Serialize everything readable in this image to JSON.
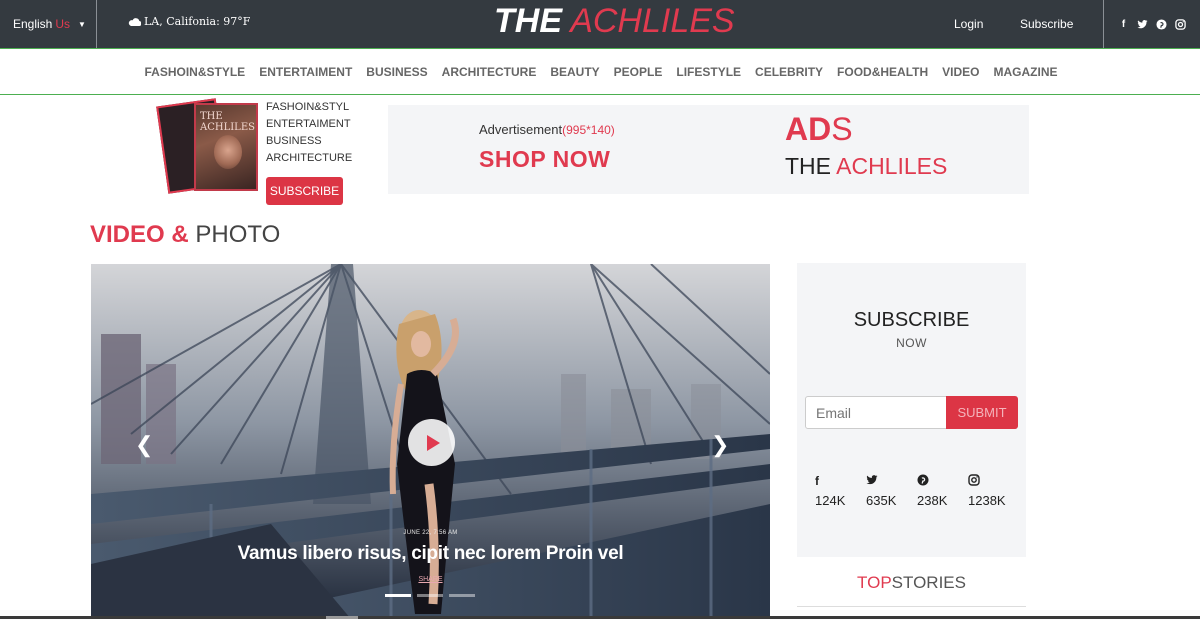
{
  "topbar": {
    "language": "English",
    "language_region": "Us",
    "weather": "LA, Califonia: 97°F",
    "logo_the": "THE",
    "logo_name": "ACHLILES",
    "login": "Login",
    "subscribe": "Subscribe",
    "social_icons": [
      "facebook-icon",
      "twitter-icon",
      "pinterest-icon",
      "instagram-icon"
    ]
  },
  "nav": {
    "items": [
      "FASHOIN&STYLE",
      "ENTERTAIMENT",
      "BUSINESS",
      "ARCHITECTURE",
      "BEAUTY",
      "PEOPLE",
      "LIFESTYLE",
      "CELEBRITY",
      "FOOD&HEALTH",
      "VIDEO",
      "MAGAZINE"
    ]
  },
  "magazine": {
    "cover_title_1": "THE",
    "cover_title_2": "ACHLILES",
    "links": [
      "FASHOIN&STYL",
      "ENTERTAIMENT",
      "BUSINESS",
      "ARCHITECTURE"
    ],
    "subscribe_button": "SUBSCRIBE"
  },
  "ad": {
    "label": "Advertisement",
    "size": "(995*140)",
    "cta": "SHOP NOW",
    "ads_big": "AD",
    "ads_small": "S",
    "brand_the": "THE",
    "brand_name": "ACHLILES"
  },
  "section": {
    "title_red": "VIDEO &",
    "title_dark": "PHOTO"
  },
  "hero": {
    "date": "JUNE 22, 7:56 AM",
    "headline": "Vamus libero risus, cipit nec lorem Proin vel",
    "share": "SHARE",
    "slide_count": 3,
    "active_slide": 1
  },
  "subscribe_box": {
    "title": "SUBSCRIBE",
    "subtitle": "NOW",
    "email_placeholder": "Email",
    "submit": "SUBMIT",
    "socials": [
      {
        "icon": "facebook-icon",
        "glyph": "f",
        "count": "124K"
      },
      {
        "icon": "twitter-icon",
        "glyph": "🐦",
        "count": "635K"
      },
      {
        "icon": "pinterest-icon",
        "glyph": "℗",
        "count": "238K"
      },
      {
        "icon": "instagram-icon",
        "glyph": "◎",
        "count": "1238K"
      }
    ]
  },
  "top_stories": {
    "red": "TOP",
    "dark": "STORIES"
  },
  "colors": {
    "accent": "#e03a4f",
    "topbar_bg": "#343a40",
    "nav_border": "#4caf50",
    "panel_bg": "#f4f5f7"
  }
}
